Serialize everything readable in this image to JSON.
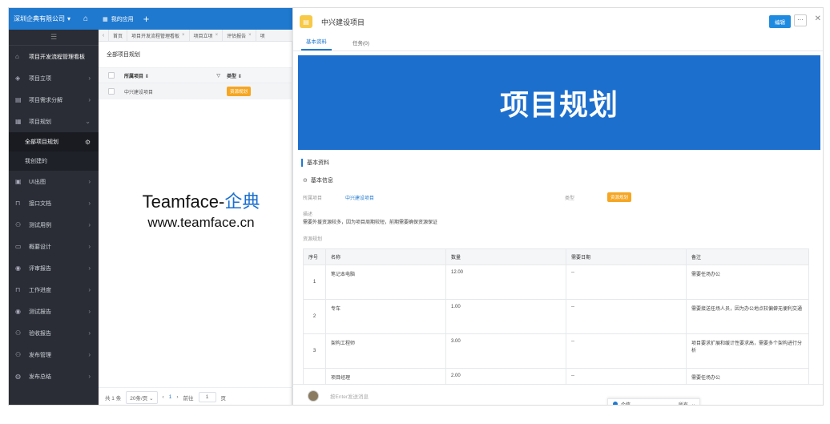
{
  "topbar": {
    "company": "深圳企典有限公司",
    "my_apps": "我的应用"
  },
  "sidebar": {
    "items": [
      {
        "label": "项目开发流程管理看板",
        "icon": "home-icon"
      },
      {
        "label": "项目立项",
        "icon": "shield-icon"
      },
      {
        "label": "项目需求分解",
        "icon": "list-icon"
      },
      {
        "label": "项目规划",
        "icon": "grid-icon"
      },
      {
        "label": "UI出图",
        "icon": "image-icon"
      },
      {
        "label": "接口文档",
        "icon": "cart-icon"
      },
      {
        "label": "测试用例",
        "icon": "team-icon"
      },
      {
        "label": "概要设计",
        "icon": "doc-icon"
      },
      {
        "label": "评审报告",
        "icon": "report-icon"
      },
      {
        "label": "工作进度",
        "icon": "cart-icon"
      },
      {
        "label": "测试报告",
        "icon": "report-icon"
      },
      {
        "label": "验收报告",
        "icon": "team-icon"
      },
      {
        "label": "发布管理",
        "icon": "team-icon"
      },
      {
        "label": "发布总结",
        "icon": "globe-icon"
      }
    ],
    "sub_items": [
      "全部项目规划",
      "我创建的"
    ]
  },
  "tabs": [
    "首页",
    "项目开发流程管理看板",
    "项目立项",
    "评估报告",
    "项"
  ],
  "list": {
    "title": "全部项目规划",
    "col_name": "所属项目",
    "col_type": "类型",
    "row": {
      "name": "中兴建设项目",
      "type": "资源规划"
    },
    "pager": {
      "total": "共 1 条",
      "size": "20条/页",
      "page": "1",
      "goto": "前往",
      "goto_value": "1",
      "unit": "页"
    }
  },
  "watermark": {
    "brand": "Teamface-",
    "brand_cn": "企典",
    "url": "www.teamface.cn"
  },
  "detail": {
    "title": "中兴建设项目",
    "edit": "编辑",
    "tabs": [
      "基本资料",
      "任务(0)"
    ],
    "banner": "项目规划",
    "section": "基本资料",
    "subsection": "基本信息",
    "project_label": "所属项目",
    "project_value": "中兴建设项目",
    "type_label": "类型",
    "type_value": "资源规划",
    "desc_label": "描述",
    "desc_text": "需要外援资源较多，因为项目周期较短，前期需要确保资源保证",
    "res_label": "资源规划",
    "table": {
      "headers": [
        "序号",
        "名称",
        "数量",
        "需要日期",
        "备注"
      ],
      "rows": [
        [
          "1",
          "笔记本电脑",
          "12.00",
          "--",
          "需要任场办公"
        ],
        [
          "2",
          "专车",
          "1.00",
          "--",
          "需要接送任场人员，因为办公地点较偏僻无便利交通"
        ],
        [
          "3",
          "架构工程师",
          "3.00",
          "--",
          "项目要求扩展和缓计性要求高，需要多个架构进行分析"
        ],
        [
          "",
          "项目经理",
          "2.00",
          "--",
          "需要任场办公"
        ]
      ]
    },
    "composer_placeholder": "按Enter发送消息",
    "popup": {
      "label": "企信",
      "option": "所有"
    }
  },
  "colors": {
    "primary": "#1f79cf",
    "sidebar_bg": "#2a2d35",
    "badge": "#f5a623",
    "banner": "#1d6fce"
  }
}
